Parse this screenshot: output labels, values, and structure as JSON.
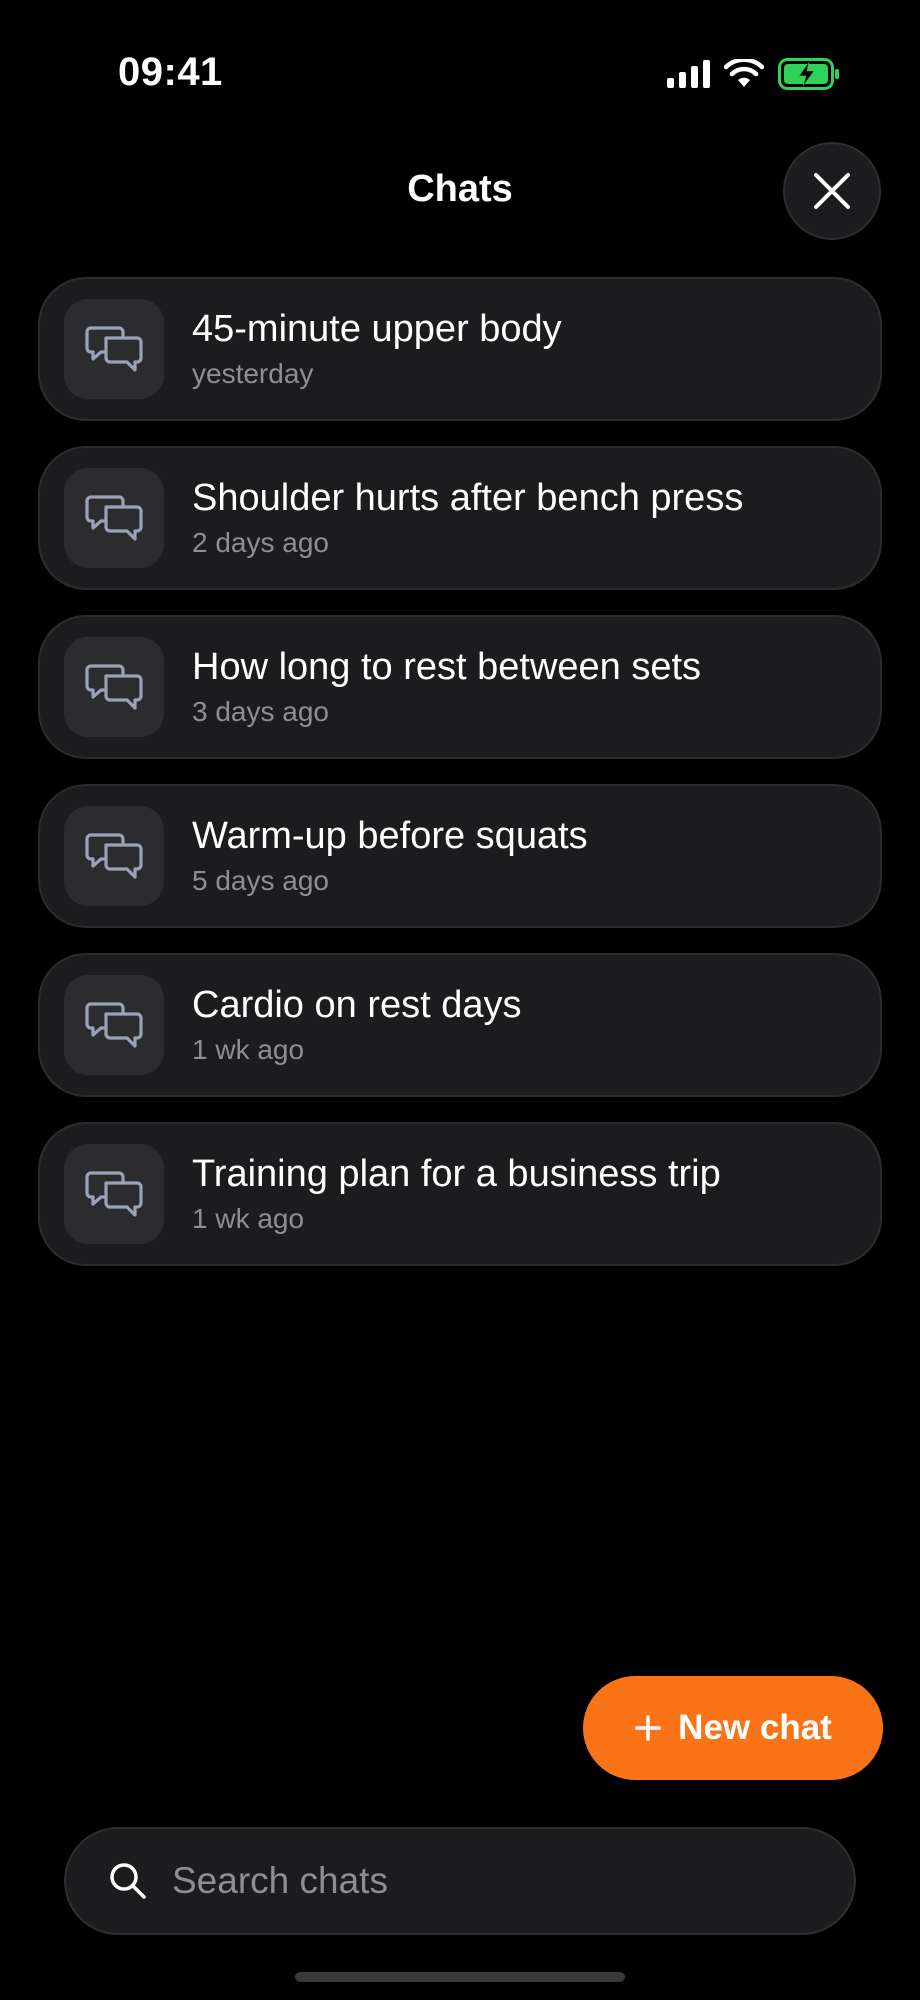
{
  "status_bar": {
    "time": "09:41",
    "icons": [
      "cellular-signal-icon",
      "wifi-icon",
      "battery-charging-icon"
    ],
    "battery_color": "#30d158"
  },
  "header": {
    "title": "Chats",
    "close_icon": "close-icon"
  },
  "chats": [
    {
      "title": "45-minute upper body",
      "time": "yesterday"
    },
    {
      "title": "Shoulder hurts after bench press",
      "time": "2 days ago"
    },
    {
      "title": "How long to rest between sets",
      "time": "3 days ago"
    },
    {
      "title": "Warm-up before squats",
      "time": "5 days ago"
    },
    {
      "title": "Cardio on rest days",
      "time": "1 wk ago"
    },
    {
      "title": "Training plan for a business trip",
      "time": "1 wk ago"
    }
  ],
  "chat_icon": "chat-bubbles-icon",
  "new_chat": {
    "label": "New chat",
    "icon": "plus-icon",
    "color": "#fa7316"
  },
  "search": {
    "placeholder": "Search chats",
    "value": "",
    "icon": "search-icon"
  }
}
